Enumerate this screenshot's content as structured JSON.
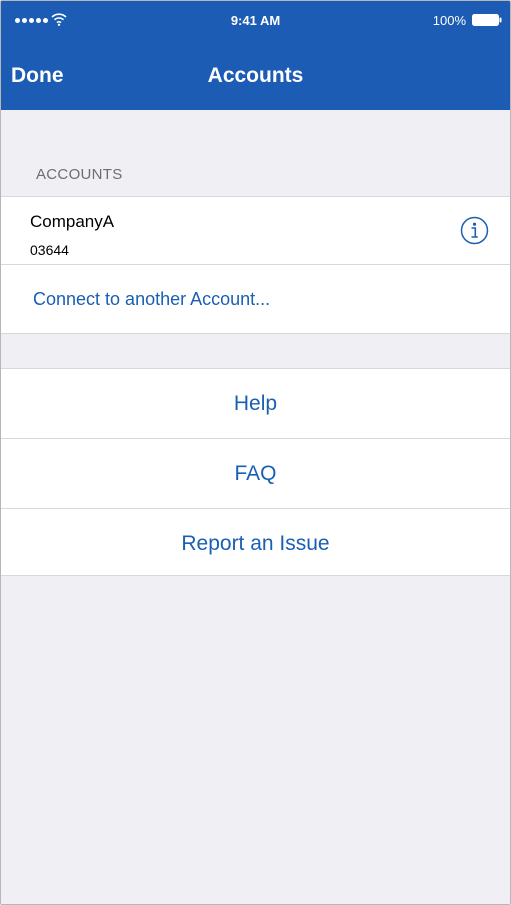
{
  "status_bar": {
    "time": "9:41 AM",
    "battery_percent": "100%",
    "signal_bars": 5,
    "icons": [
      "signal-dots-icon",
      "wifi-icon",
      "battery-icon"
    ]
  },
  "nav": {
    "done_label": "Done",
    "title": "Accounts"
  },
  "accounts_section": {
    "header": "ACCOUNTS",
    "accounts": [
      {
        "name": "CompanyA",
        "number": "03644",
        "icon": "info-icon"
      }
    ],
    "connect_label": "Connect to another Account..."
  },
  "links": [
    {
      "label": "Help"
    },
    {
      "label": "FAQ"
    },
    {
      "label": "Report an Issue"
    }
  ],
  "colors": {
    "nav_background": "#1d5cb5",
    "link_blue": "#1b5fb3",
    "page_background": "#efeff4",
    "row_background": "#ffffff",
    "separator": "#d8d8dc",
    "section_header_text": "#6d6d72"
  }
}
